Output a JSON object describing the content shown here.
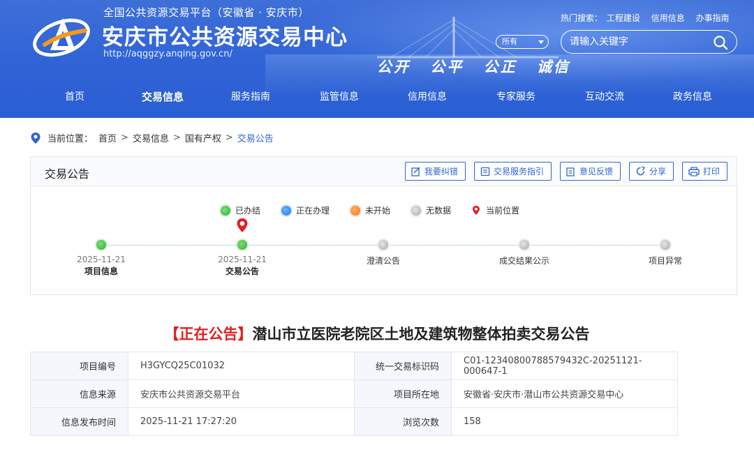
{
  "header": {
    "platform_line": "全国公共资源交易平台（安徽省 · 安庆市）",
    "site_name": "安庆市公共资源交易中心",
    "site_url": "http://aqggzy.anqing.gov.cn/",
    "hot_label": "热门搜索：",
    "hot_keywords": [
      "工程建设",
      "信用信息",
      "办事指南"
    ],
    "scope_select": "所有",
    "search_placeholder": "请输入关键字",
    "slogan": [
      "公开",
      "公平",
      "公正",
      "诚信"
    ],
    "brand_color": "#2f63d6"
  },
  "nav": {
    "items": [
      "首页",
      "交易信息",
      "服务指南",
      "监管信息",
      "信用信息",
      "专家服务",
      "互动交流",
      "政务信息"
    ],
    "active": "交易信息"
  },
  "breadcrumb": {
    "label": "当前位置：",
    "items": [
      "首页",
      "交易信息",
      "国有产权",
      "交易公告"
    ]
  },
  "panel": {
    "title": "交易公告",
    "tools": [
      "我要纠错",
      "交易服务指引",
      "意见反馈",
      "分享",
      "打印"
    ],
    "legend": [
      {
        "status": "done",
        "label": "已办结",
        "color": "#2fa82e"
      },
      {
        "status": "doing",
        "label": "正在办理",
        "color": "#1e7be6"
      },
      {
        "status": "todo",
        "label": "未开始",
        "color": "#f07316"
      },
      {
        "status": "none",
        "label": "无数据",
        "color": "#a8a8a8"
      },
      {
        "status": "current",
        "label": "当前位置",
        "color": "#e0202a"
      }
    ],
    "steps": [
      {
        "name": "项目信息",
        "date": "2025-11-21",
        "status": "done"
      },
      {
        "name": "交易公告",
        "date": "2025-11-21",
        "status": "done",
        "current": true
      },
      {
        "name": "澄清公告",
        "date": "",
        "status": "none"
      },
      {
        "name": "成交结果公示",
        "date": "",
        "status": "none"
      },
      {
        "name": "项目异常",
        "date": "",
        "status": "none"
      }
    ]
  },
  "announcement": {
    "tag": "【正在公告】",
    "title": "潜山市立医院老院区土地及建筑物整体拍卖交易公告"
  },
  "info": {
    "project_no_label": "项目编号",
    "project_no": "H3GYCQ25C01032",
    "unified_id_label": "统一交易标识码",
    "unified_id": "C01-12340800788579432C-20251121-000647-1",
    "source_label": "信息来源",
    "source": "安庆市公共资源交易平台",
    "location_label": "项目所在地",
    "location": "安徽省·安庆市·潜山市公共资源交易中心",
    "publish_time_label": "信息发布时间",
    "publish_time": "2025-11-21 17:27:20",
    "views_label": "浏览次数",
    "views": "158"
  }
}
